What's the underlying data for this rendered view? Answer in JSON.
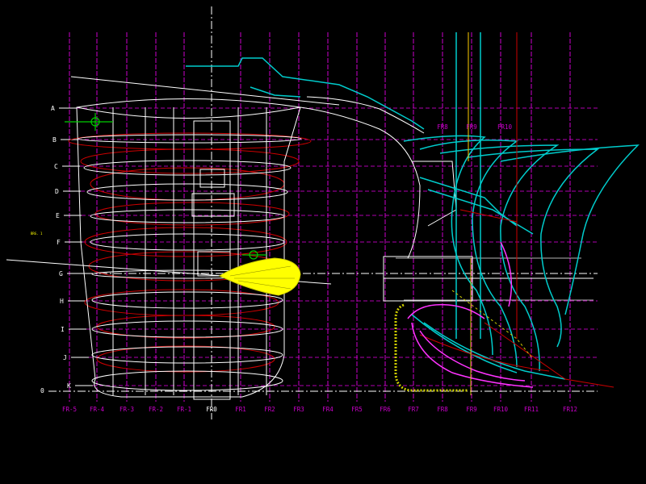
{
  "frames": {
    "labels": [
      "FR-5",
      "FR-4",
      "FR-3",
      "FR-2",
      "FR-1",
      "FR0",
      "FR1",
      "FR2",
      "FR3",
      "FR4",
      "FR5",
      "FR6",
      "FR7",
      "FR8",
      "FR9",
      "FR10",
      "FR11",
      "FR12"
    ],
    "upper_labels": [
      "FR8",
      "FR9",
      "FR10"
    ]
  },
  "waterlines": {
    "labels": [
      "A",
      "B",
      "C",
      "D",
      "E",
      "F",
      "G",
      "H",
      "I",
      "J",
      "K",
      "0"
    ]
  },
  "side_note": "BRG. 1",
  "colors": {
    "background": "#000000",
    "hull": "#ffffff",
    "frame_grid": "#cc00cc",
    "stern_sections": "#00cccc",
    "waterline_ellipses": "#cc0000",
    "propeller": "#ffff00",
    "marker": "#00cc00",
    "skeg_profile": "#ff33ff"
  }
}
